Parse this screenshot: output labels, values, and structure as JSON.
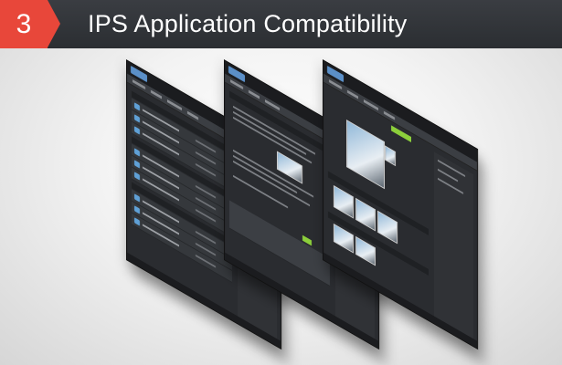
{
  "banner": {
    "step_number": "3",
    "title": "IPS Application Compatibility",
    "colors": {
      "badge": "#e8473a",
      "bar": "#2b2e32",
      "text": "#ffffff"
    }
  },
  "mockups": {
    "count": 3,
    "theme": "dark",
    "accent": "#8ccf3b",
    "link": "#5fa0d6"
  }
}
